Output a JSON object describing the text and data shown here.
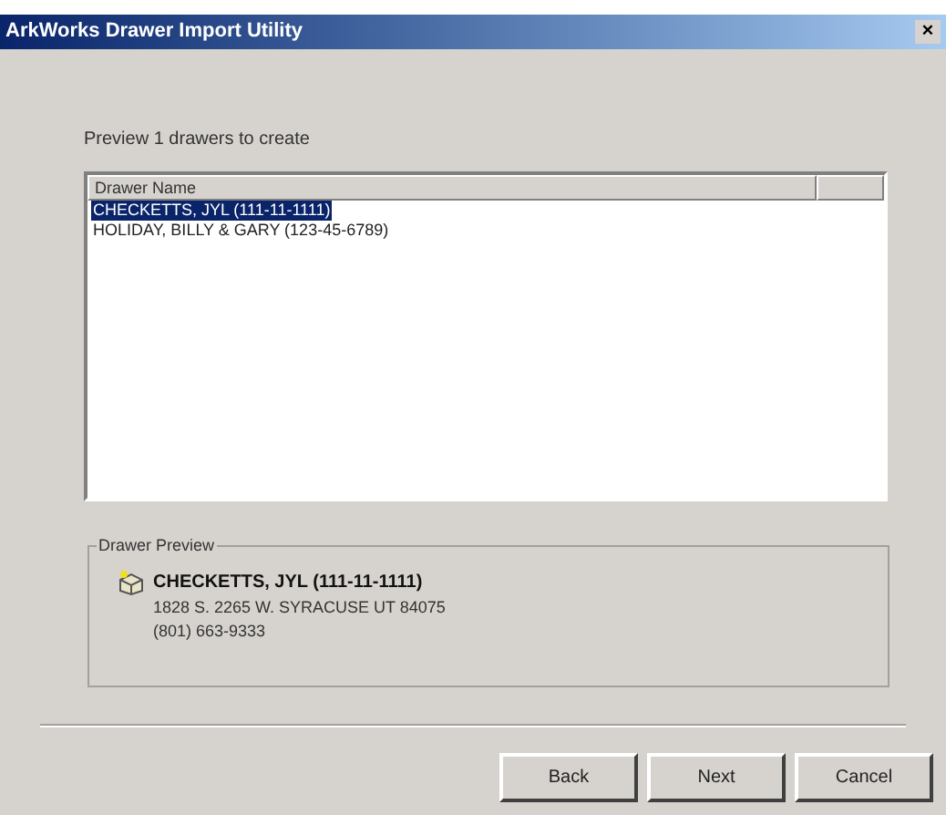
{
  "window": {
    "title": "ArkWorks Drawer Import Utility",
    "close": "×"
  },
  "prompt": "Preview 1 drawers to create",
  "list": {
    "columns": [
      "Drawer Name"
    ],
    "rows": [
      {
        "name": "CHECKETTS, JYL (111-11-1111)",
        "selected": true
      },
      {
        "name": "HOLIDAY, BILLY & GARY (123-45-6789)",
        "selected": false
      }
    ]
  },
  "preview": {
    "title": "Drawer Preview",
    "name": "CHECKETTS, JYL (111-11-1111)",
    "address": "1828 S. 2265 W. SYRACUSE UT 84075",
    "phone": "(801) 663-9333"
  },
  "buttons": [
    "Back",
    "Next",
    "Cancel"
  ]
}
